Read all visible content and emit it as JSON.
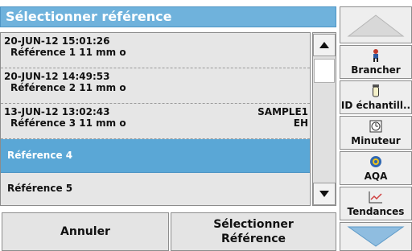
{
  "title": "Sélectionner référence",
  "references": [
    {
      "date": "20-JUN-12  15:01:26",
      "name": "Référence 1  11 mm o",
      "sample": "",
      "extra": ""
    },
    {
      "date": "20-JUN-12  14:49:53",
      "name": "Référence 2  11 mm o",
      "sample": "",
      "extra": ""
    },
    {
      "date": "13-JUN-12  13:02:43",
      "name": "Référence 3  11 mm o",
      "sample": "SAMPLE1",
      "extra": "EH"
    },
    {
      "label": "Référence 4",
      "selected": true
    },
    {
      "label": "Référence 5"
    }
  ],
  "buttons": {
    "cancel": "Annuler",
    "select_line1": "Sélectionner",
    "select_line2": "Référence"
  },
  "sidebar": {
    "connect": "Brancher",
    "sample_id": "ID échantill..",
    "timer": "Minuteur",
    "aqa": "AQA",
    "trends": "Tendances"
  },
  "icons": {
    "scroll_up": "triangle-up-icon",
    "scroll_down": "triangle-down-icon",
    "page_up": "page-up-icon",
    "page_down": "page-down-icon",
    "connect": "person-icon",
    "sample_id": "vial-icon",
    "timer": "clock-icon",
    "aqa": "qa-icon",
    "trends": "trend-chart-icon"
  },
  "colors": {
    "title_bg": "#6fb2dc",
    "selection": "#5aa7d6",
    "nav_arrow": "#8fbde0"
  }
}
